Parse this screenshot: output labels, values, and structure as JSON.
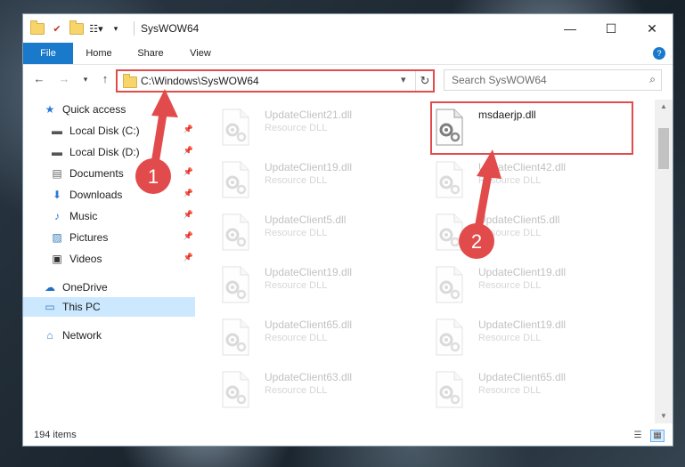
{
  "window": {
    "title": "SysWOW64",
    "controls": {
      "minimize": "—",
      "maximize": "☐",
      "close": "✕"
    }
  },
  "ribbon": {
    "tabs": [
      "File",
      "Home",
      "Share",
      "View"
    ],
    "help_glyph": "?"
  },
  "nav": {
    "address": "C:\\Windows\\SysWOW64",
    "search_placeholder": "Search SysWOW64"
  },
  "sidebar": {
    "items": [
      {
        "label": "Quick access",
        "icon": "star-icon",
        "pinned": false
      },
      {
        "label": "Local Disk (C:)",
        "icon": "drive-icon",
        "pinned": true
      },
      {
        "label": "Local Disk (D:)",
        "icon": "drive-icon",
        "pinned": true
      },
      {
        "label": "Documents",
        "icon": "documents-icon",
        "pinned": true
      },
      {
        "label": "Downloads",
        "icon": "download-icon",
        "pinned": true
      },
      {
        "label": "Music",
        "icon": "music-icon",
        "pinned": true
      },
      {
        "label": "Pictures",
        "icon": "pictures-icon",
        "pinned": true
      },
      {
        "label": "Videos",
        "icon": "videos-icon",
        "pinned": true
      },
      {
        "label": "OneDrive",
        "icon": "cloud-icon",
        "pinned": false
      },
      {
        "label": "This PC",
        "icon": "computer-icon",
        "pinned": false,
        "selected": true
      },
      {
        "label": "Network",
        "icon": "network-icon",
        "pinned": false
      }
    ]
  },
  "files": [
    {
      "name": "UpdateClient21.dll",
      "type": "Resource DLL"
    },
    {
      "name": "msdaerjp.dll",
      "type": "",
      "highlighted": true
    },
    {
      "name": "UpdateClient19.dll",
      "type": "Resource DLL"
    },
    {
      "name": "UpdateClient42.dll",
      "type": "Resource DLL"
    },
    {
      "name": "UpdateClient5.dll",
      "type": "Resource DLL"
    },
    {
      "name": "UpdateClient5.dll",
      "type": "Resource DLL"
    },
    {
      "name": "UpdateClient19.dll",
      "type": "Resource DLL"
    },
    {
      "name": "UpdateClient19.dll",
      "type": "Resource DLL"
    },
    {
      "name": "UpdateClient65.dll",
      "type": "Resource DLL"
    },
    {
      "name": "UpdateClient19.dll",
      "type": "Resource DLL"
    },
    {
      "name": "UpdateClient63.dll",
      "type": "Resource DLL"
    },
    {
      "name": "UpdateClient65.dll",
      "type": "Resource DLL"
    }
  ],
  "status": {
    "item_count": "194 items"
  },
  "annotations": {
    "step1": "1",
    "step2": "2",
    "color": "#e24b4b"
  }
}
